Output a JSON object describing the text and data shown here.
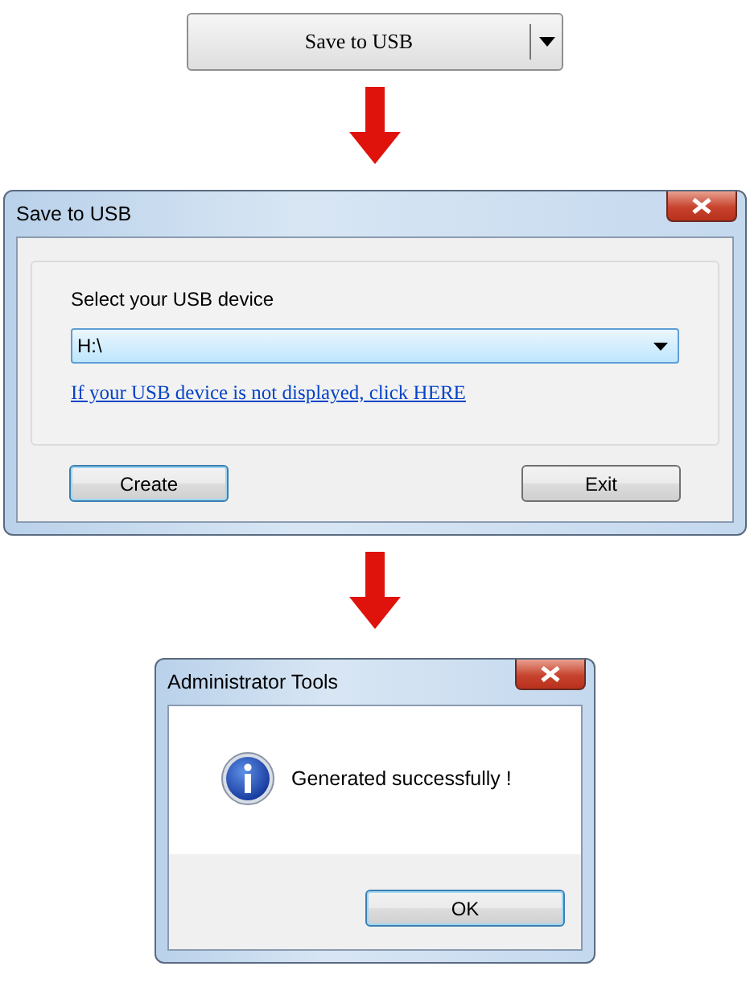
{
  "split_button": {
    "label": "Save to USB"
  },
  "save_dialog": {
    "title": "Save to USB",
    "prompt": "Select your USB device",
    "device": {
      "value": "H:\\"
    },
    "help_link": "If your USB device is not displayed, click HERE",
    "buttons": [
      {
        "label": "Create",
        "focused": true
      },
      {
        "label": "Exit",
        "focused": false
      }
    ]
  },
  "message_dialog": {
    "title": "Administrator Tools",
    "message": "Generated successfully !",
    "buttons": [
      {
        "label": "OK",
        "focused": true
      }
    ]
  }
}
